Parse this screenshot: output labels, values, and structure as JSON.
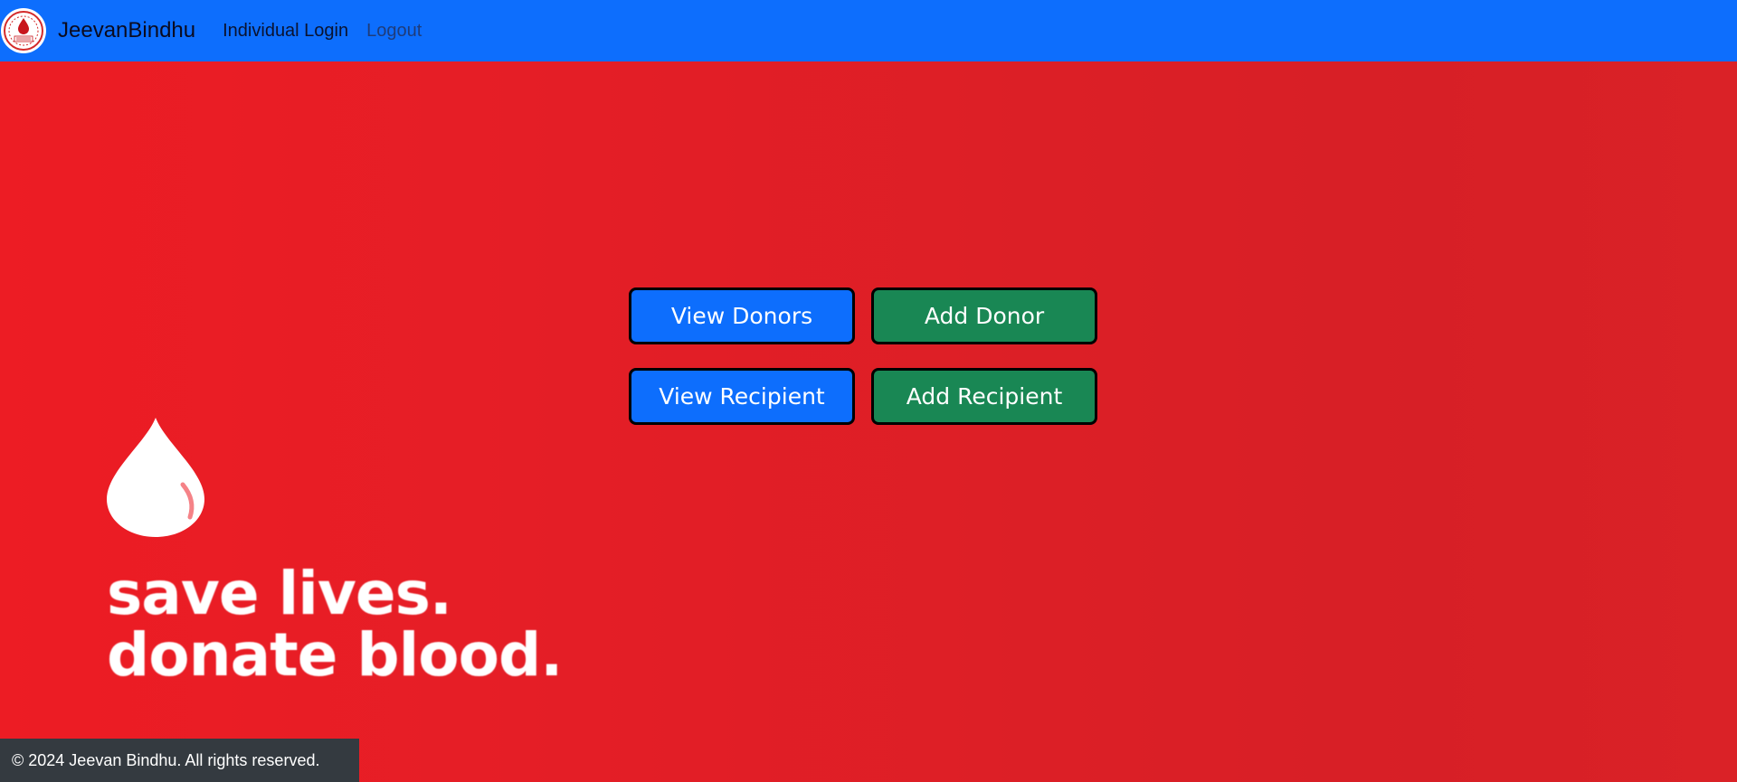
{
  "navbar": {
    "brand": "JeevanBindhu",
    "logo_icon": "blood-drop-logo-icon",
    "links": [
      {
        "label": "Individual Login"
      },
      {
        "label": "Logout"
      }
    ]
  },
  "actions": [
    {
      "label": "View Donors",
      "color": "#0d6efd"
    },
    {
      "label": "Add Donor",
      "color": "#198754"
    },
    {
      "label": "View Recipient",
      "color": "#0d6efd"
    },
    {
      "label": "Add Recipient",
      "color": "#198754"
    }
  ],
  "hero": {
    "icon": "blood-drop-icon",
    "slogan_line1": "save lives.",
    "slogan_line2": "donate blood."
  },
  "footer": {
    "text": "© 2024 Jeevan Bindhu. All rights reserved."
  },
  "colors": {
    "navbar": "#0d6efd",
    "hero_red": "#ed1c24",
    "footer": "#343a40"
  }
}
